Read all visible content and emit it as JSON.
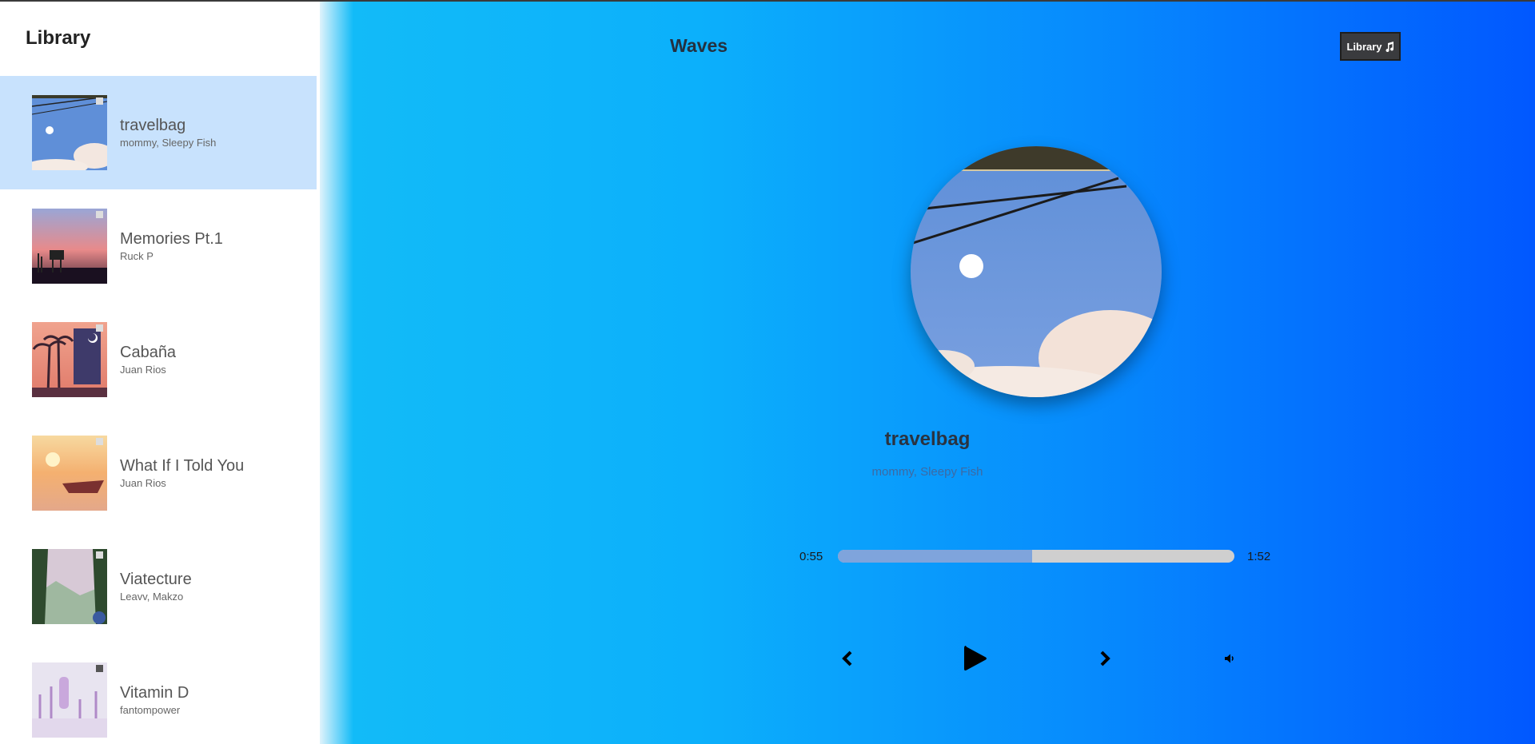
{
  "sidebar": {
    "title": "Library",
    "songs": [
      {
        "name": "travelbag",
        "artist": "mommy, Sleepy Fish",
        "selected": true
      },
      {
        "name": "Memories Pt.1",
        "artist": "Ruck P",
        "selected": false
      },
      {
        "name": "Cabaña",
        "artist": "Juan Rios",
        "selected": false
      },
      {
        "name": "What If I Told You",
        "artist": "Juan Rios",
        "selected": false
      },
      {
        "name": "Viatecture",
        "artist": "Leavv, Makzo",
        "selected": false
      },
      {
        "name": "Vitamin D",
        "artist": "fantompower",
        "selected": false
      }
    ]
  },
  "nav": {
    "title": "Waves",
    "library_button": "Library",
    "library_icon": "music-note-icon"
  },
  "player": {
    "title": "travelbag",
    "artist": "mommy, Sleepy Fish",
    "current_time": "0:55",
    "total_time": "1:52",
    "progress_fraction": 0.49,
    "icons": [
      "chevron-left-icon",
      "play-icon",
      "chevron-right-icon",
      "volume-icon"
    ]
  },
  "colors": {
    "accent_blue": "#0cb0fb",
    "selected_row": "#c8e2fd",
    "progress_fill": "#7fa4dc",
    "track": "#cfcfcf"
  }
}
